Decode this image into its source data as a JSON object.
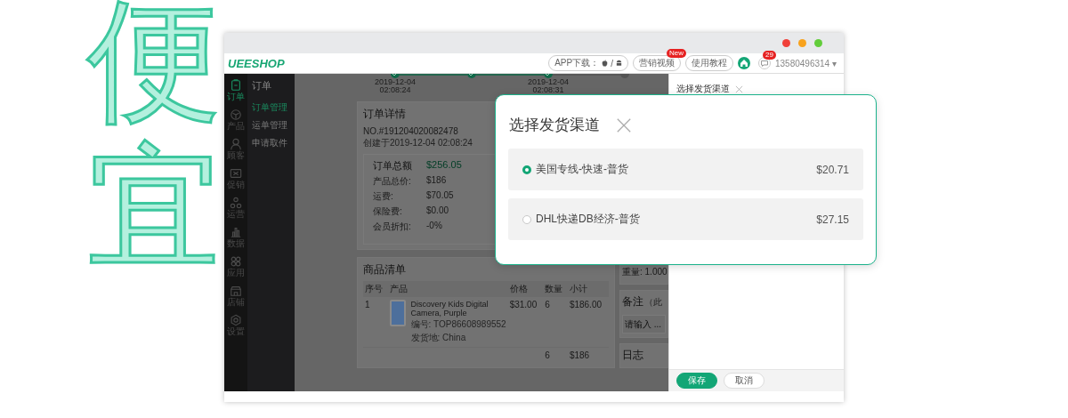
{
  "hero_text": "便宜",
  "topbar": {
    "logo": "UEESHOP",
    "app_download": "APP下载：",
    "separator": "/",
    "buttons": [
      {
        "label": "营销视频",
        "badge": "New"
      },
      {
        "label": "使用教程"
      }
    ],
    "message_count": "29",
    "phone": "13580496314",
    "caret": "▾"
  },
  "nav_rail": [
    {
      "label": "订单",
      "selected": true
    },
    {
      "label": "产品",
      "selected": false
    },
    {
      "label": "顾客",
      "selected": false
    },
    {
      "label": "促销",
      "selected": false
    },
    {
      "label": "运营",
      "selected": false
    },
    {
      "label": "数据",
      "selected": false
    },
    {
      "label": "应用",
      "selected": false
    },
    {
      "label": "店铺",
      "selected": false
    },
    {
      "label": "设置",
      "selected": false
    }
  ],
  "submenu": {
    "title": "订单",
    "items": [
      {
        "label": "订单管理",
        "selected": true
      },
      {
        "label": "运单管理",
        "selected": false
      },
      {
        "label": "申请取件",
        "selected": false
      }
    ]
  },
  "progress_steps": [
    {
      "done": true,
      "date": "2019-12-04",
      "time": "02:08:24"
    },
    {
      "done": true
    },
    {
      "done": true,
      "date": "2019-12-04",
      "time": "02:08:31"
    },
    {
      "done": false
    }
  ],
  "order_detail": {
    "title": "订单详情",
    "number": "NO.#191204020082478",
    "created": "创建于2019-12-04 02:08:24",
    "total_label": "订单总额",
    "total": "$256.05",
    "lines": [
      {
        "label": "产品总价:",
        "value": "$186"
      },
      {
        "label": "运费:",
        "value": "$70.05"
      },
      {
        "label": "保险费:",
        "value": "$0.00"
      },
      {
        "label": "会员折扣:",
        "value": "-0%"
      }
    ]
  },
  "product_list": {
    "title": "商品清单",
    "columns": [
      "序号",
      "产品",
      "价格",
      "数量",
      "小计"
    ],
    "rows": [
      {
        "index": "1",
        "name": "Discovery Kids Digital Camera, Purple",
        "sku": "编号: TOP86608989552",
        "origin": "发货地: China",
        "price": "$31.00",
        "quantity": "6",
        "subtotal": "$186.00"
      }
    ],
    "totals": {
      "quantity": "6",
      "subtotal": "$186"
    }
  },
  "side_cards": {
    "weight": "重量: 1.000",
    "note_title": "备注",
    "note_hint": "（此",
    "note_placeholder": "请输入 ...",
    "log_title": "日志"
  },
  "drawer": {
    "title": "选择发货渠道",
    "buttons": [
      {
        "label": "保存",
        "kind": "primary"
      },
      {
        "label": "取消",
        "kind": "secondary"
      }
    ]
  },
  "dialog": {
    "title": "选择发货渠道",
    "options": [
      {
        "name": "美国专线-快速-普货",
        "price": "$20.71",
        "selected": true
      },
      {
        "name": "DHL快递DB经济-普货",
        "price": "$27.15",
        "selected": false
      }
    ]
  }
}
